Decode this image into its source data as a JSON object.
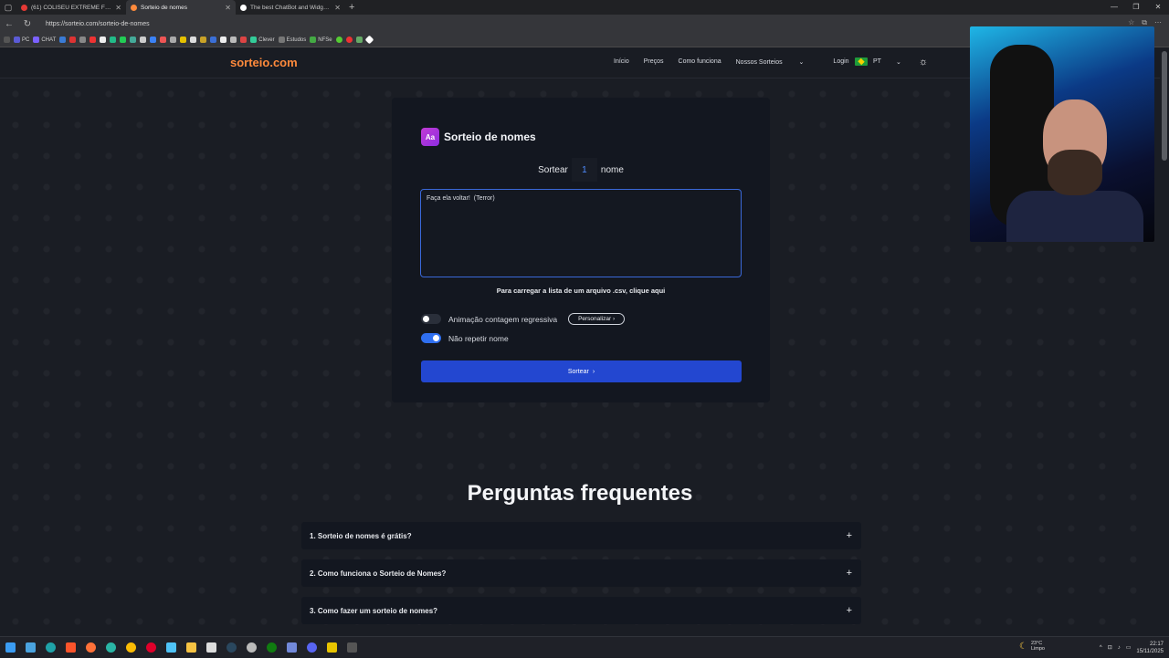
{
  "browser": {
    "tabs": [
      {
        "title": "(61) COLISEU EXTREME FIGHT - A",
        "fav_color": "#e53935",
        "active": false
      },
      {
        "title": "Sorteio de nomes",
        "fav_color": "#ff8a3c",
        "active": true
      },
      {
        "title": "The best ChatBot and Widgets fo",
        "fav_color": "#ffffff",
        "active": false
      }
    ],
    "url": "https://sorteio.com/sorteio-de-nomes",
    "bookmarks": [
      "PC",
      "CHAT",
      "Clever",
      "Estudos",
      "NFSe"
    ]
  },
  "site": {
    "logo": "sorteio.com",
    "nav": [
      "Início",
      "Preços",
      "Como funciona",
      "Nossos Sorteios",
      "Login"
    ],
    "nav_dropdown_icon": "chevron-down-icon",
    "language": "PT",
    "theme_icon": "sun-icon"
  },
  "card": {
    "icon_text": "Aa",
    "title": "Sorteio de nomes",
    "count_prefix": "Sortear",
    "count_value": "1",
    "count_suffix": "nome",
    "names_text": "Faça ela voltar!  (Terror)",
    "csv_link": "Para carregar a lista de um arquivo .csv, clique aqui",
    "toggle_countdown": {
      "label": "Animação contagem regressiva",
      "on": false
    },
    "customize_label": "Personalizar",
    "toggle_norepeat": {
      "label": "Não repetir nome",
      "on": true
    },
    "submit_label": "Sortear"
  },
  "faq": {
    "title": "Perguntas frequentes",
    "items": [
      "1. Sorteio de nomes é grátis?",
      "2. Como funciona o Sorteio de Nomes?",
      "3. Como fazer um sorteio de nomes?"
    ]
  },
  "taskbar": {
    "weather_temp": "23°C",
    "weather_desc": "Limpo",
    "time": "22:17",
    "date": "15/11/2025"
  },
  "colors": {
    "accent": "#2347d0",
    "logo": "#ff8a3c",
    "toggle_on": "#2f6ff0"
  }
}
